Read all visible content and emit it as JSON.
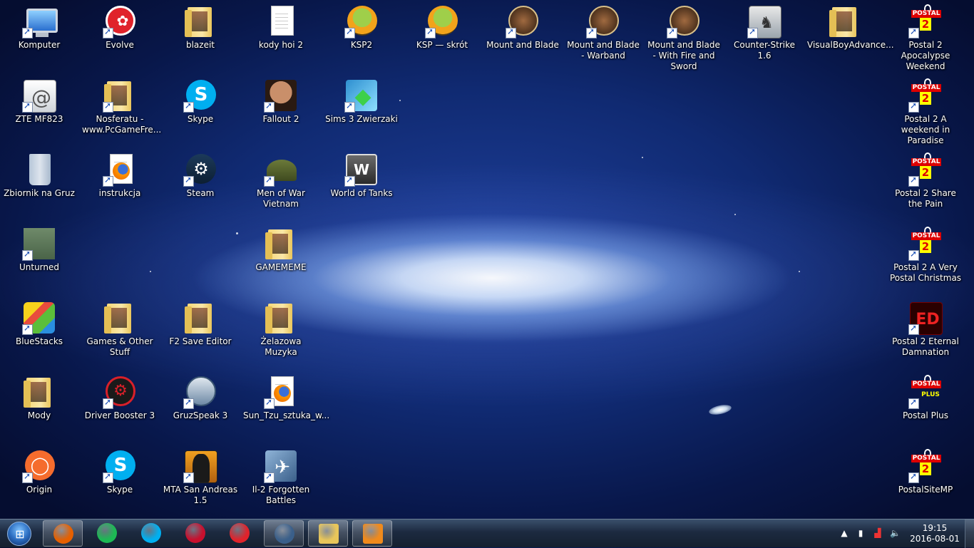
{
  "desktop": {
    "icons": [
      {
        "label": "Komputer",
        "kind": "monitor"
      },
      {
        "label": "Evolve",
        "kind": "evolve"
      },
      {
        "label": "blazeit",
        "kind": "folder"
      },
      {
        "label": "kody hoi 2",
        "kind": "doc"
      },
      {
        "label": "KSP2",
        "kind": "kerbal"
      },
      {
        "label": "KSP — skrót",
        "kind": "kerbal"
      },
      {
        "label": "Mount and Blade",
        "kind": "mab"
      },
      {
        "label": "Mount and Blade - Warband",
        "kind": "mab"
      },
      {
        "label": "Mount and Blade - With Fire and Sword",
        "kind": "mab"
      },
      {
        "label": "Counter-Strike 1.6",
        "kind": "cs"
      },
      {
        "label": "VisualBoyAdvance...",
        "kind": "folder"
      },
      {
        "label": "Postal 2 Apocalypse Weekend",
        "kind": "postal"
      },
      {
        "label": "ZTE MF823",
        "kind": "at"
      },
      {
        "label": "Nosferatu - www.PcGameFre...",
        "kind": "folder"
      },
      {
        "label": "Skype",
        "kind": "skype"
      },
      {
        "label": "Fallout 2",
        "kind": "fallout"
      },
      {
        "label": "Sims 3 Zwierzaki",
        "kind": "sims"
      },
      {
        "label": "Postal 2 A weekend in Paradise",
        "kind": "postal"
      },
      {
        "label": "Zbiornik na Gruz",
        "kind": "bin"
      },
      {
        "label": "instrukcja",
        "kind": "firefoxdoc"
      },
      {
        "label": "Steam",
        "kind": "steam"
      },
      {
        "label": "Men of War Vietnam",
        "kind": "helmet"
      },
      {
        "label": "World of Tanks",
        "kind": "wot"
      },
      {
        "label": "Postal 2 Share the Pain",
        "kind": "postal"
      },
      {
        "label": "Unturned",
        "kind": "unturned"
      },
      {
        "label": "GAMEMEME",
        "kind": "folder"
      },
      {
        "label": "Postal 2 A Very Postal Christmas",
        "kind": "postal"
      },
      {
        "label": "BlueStacks",
        "kind": "bluestacks"
      },
      {
        "label": "Games & Other Stuff",
        "kind": "folder"
      },
      {
        "label": "F2 Save Editor",
        "kind": "folder"
      },
      {
        "label": "Żelazowa Muzyka",
        "kind": "folder"
      },
      {
        "label": "Postal 2 Eternal Damnation",
        "kind": "ed"
      },
      {
        "label": "Mody",
        "kind": "folder"
      },
      {
        "label": "Driver Booster 3",
        "kind": "driver"
      },
      {
        "label": "GruzSpeak 3",
        "kind": "ts"
      },
      {
        "label": "Sun_Tzu_sztuka_w...",
        "kind": "firefoxdoc"
      },
      {
        "label": "Postal Plus",
        "kind": "postalplus"
      },
      {
        "label": "Origin",
        "kind": "origin"
      },
      {
        "label": "Skype",
        "kind": "skype"
      },
      {
        "label": "MTA San Andreas 1.5",
        "kind": "mta"
      },
      {
        "label": "Il-2 Forgotten Battles",
        "kind": "il2"
      },
      {
        "label": "PostalSiteMP",
        "kind": "postal"
      }
    ],
    "postal_text": "POSTAL",
    "postal_num": "2",
    "postalplus_text": "PLUS",
    "ed_text": "ED",
    "at_text": "@"
  },
  "taskbar": {
    "buttons": [
      {
        "name": "firefox",
        "color": "#e66000"
      },
      {
        "name": "spotify",
        "color": "#1db954"
      },
      {
        "name": "skype",
        "color": "#00aff0"
      },
      {
        "name": "driver-booster",
        "color": "#c8102e"
      },
      {
        "name": "evolve",
        "color": "#e0232b"
      },
      {
        "name": "teamspeak",
        "color": "#3a5f8a"
      },
      {
        "name": "explorer",
        "color": "#e8c65a"
      },
      {
        "name": "media-player",
        "color": "#f08a1c"
      }
    ],
    "clock_time": "19:15",
    "clock_date": "2016-08-01"
  }
}
